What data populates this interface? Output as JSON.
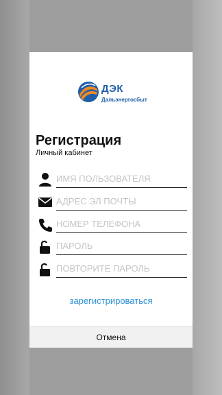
{
  "brand": {
    "name": "ДЭК",
    "subtitle": "Дальэнергосбыт",
    "colors": {
      "blue": "#1f5fa8",
      "orange": "#f08a24"
    }
  },
  "form": {
    "title": "Регистрация",
    "subtitle": "Личный кабинет",
    "fields": [
      {
        "icon": "person-icon",
        "placeholder": "ИМЯ ПОЛЬЗОВАТЕЛЯ",
        "value": ""
      },
      {
        "icon": "envelope-icon",
        "placeholder": "АДРЕС ЭЛ ПОЧТЫ",
        "value": ""
      },
      {
        "icon": "phone-icon",
        "placeholder": "НОМЕР ТЕЛЕФОНА",
        "value": ""
      },
      {
        "icon": "lock-icon",
        "placeholder": "ПАРОЛЬ",
        "value": ""
      },
      {
        "icon": "lock-icon",
        "placeholder": "ПОВТОРИТЕ ПАРОЛЬ",
        "value": ""
      }
    ],
    "register_label": "зарегистрироваться",
    "register_color": "#2a8fd6"
  },
  "footer": {
    "cancel_label": "Отмена"
  }
}
